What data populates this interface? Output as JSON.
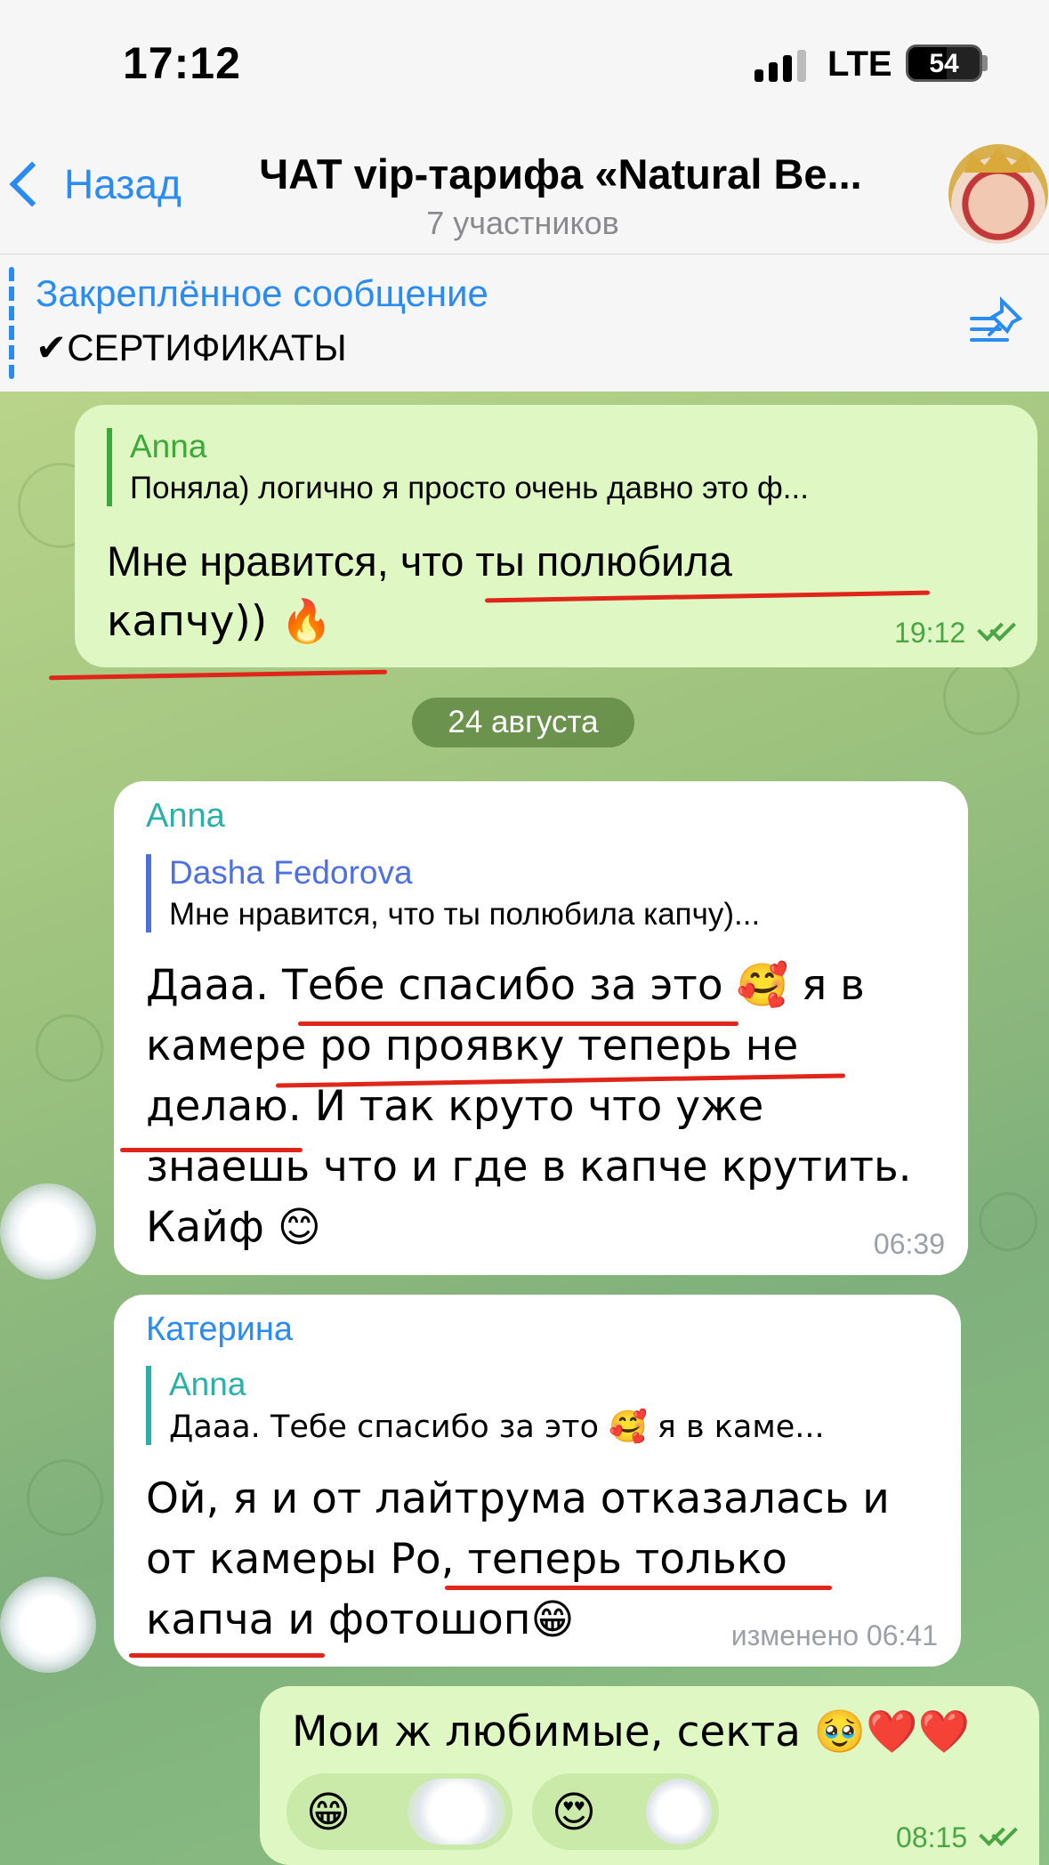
{
  "status_bar": {
    "time": "17:12",
    "network": "LTE",
    "battery": "54",
    "battery_level": 0.54
  },
  "nav": {
    "back_label": "Назад",
    "title": "ЧАТ vip-тарифа «Natural Be...",
    "subtitle": "7 участников"
  },
  "pinned": {
    "title": "Закреплённое сообщение",
    "text": "✔СЕРТИФИКАТЫ"
  },
  "messages": [
    {
      "reply_name": "Anna",
      "reply_text": "Поняла) логично я просто очень давно это ф...",
      "line1": "Мне нравится, что ты полюбила",
      "line2": "капчу)) 🔥",
      "time": "19:12"
    },
    {
      "sender": "Anna",
      "reply_name": "Dasha Fedorova",
      "reply_text": "Мне нравится, что ты полюбила капчу)...",
      "line1": "Дааа. Тебе спасибо за это 🥰 я в",
      "line2": "камере ро проявку теперь не",
      "line3": "делаю. И так круто что уже",
      "line4": "знаешь что и где в капче крутить.",
      "line5": "Кайф 😊",
      "time": "06:39"
    },
    {
      "sender": "Катерина",
      "reply_name": "Anna",
      "reply_text": "Дааа. Тебе спасибо за это 🥰 я в каме...",
      "line1": "Ой, я и от лайтрума отказалась и",
      "line2": "от камеры Ро, теперь только",
      "line3": "капча и фотошоп😁",
      "time": "изменено 06:41"
    },
    {
      "text": "Мои ж любимые, секта 🥹❤️❤️",
      "reactions": [
        "😁",
        "😍"
      ],
      "time": "08:15"
    }
  ],
  "date_separator": "24 августа",
  "colors": {
    "accent": "#2a8cf1",
    "out_bubble": "#dff7c3",
    "underline": "#e0251a",
    "check": "#4aa544"
  }
}
